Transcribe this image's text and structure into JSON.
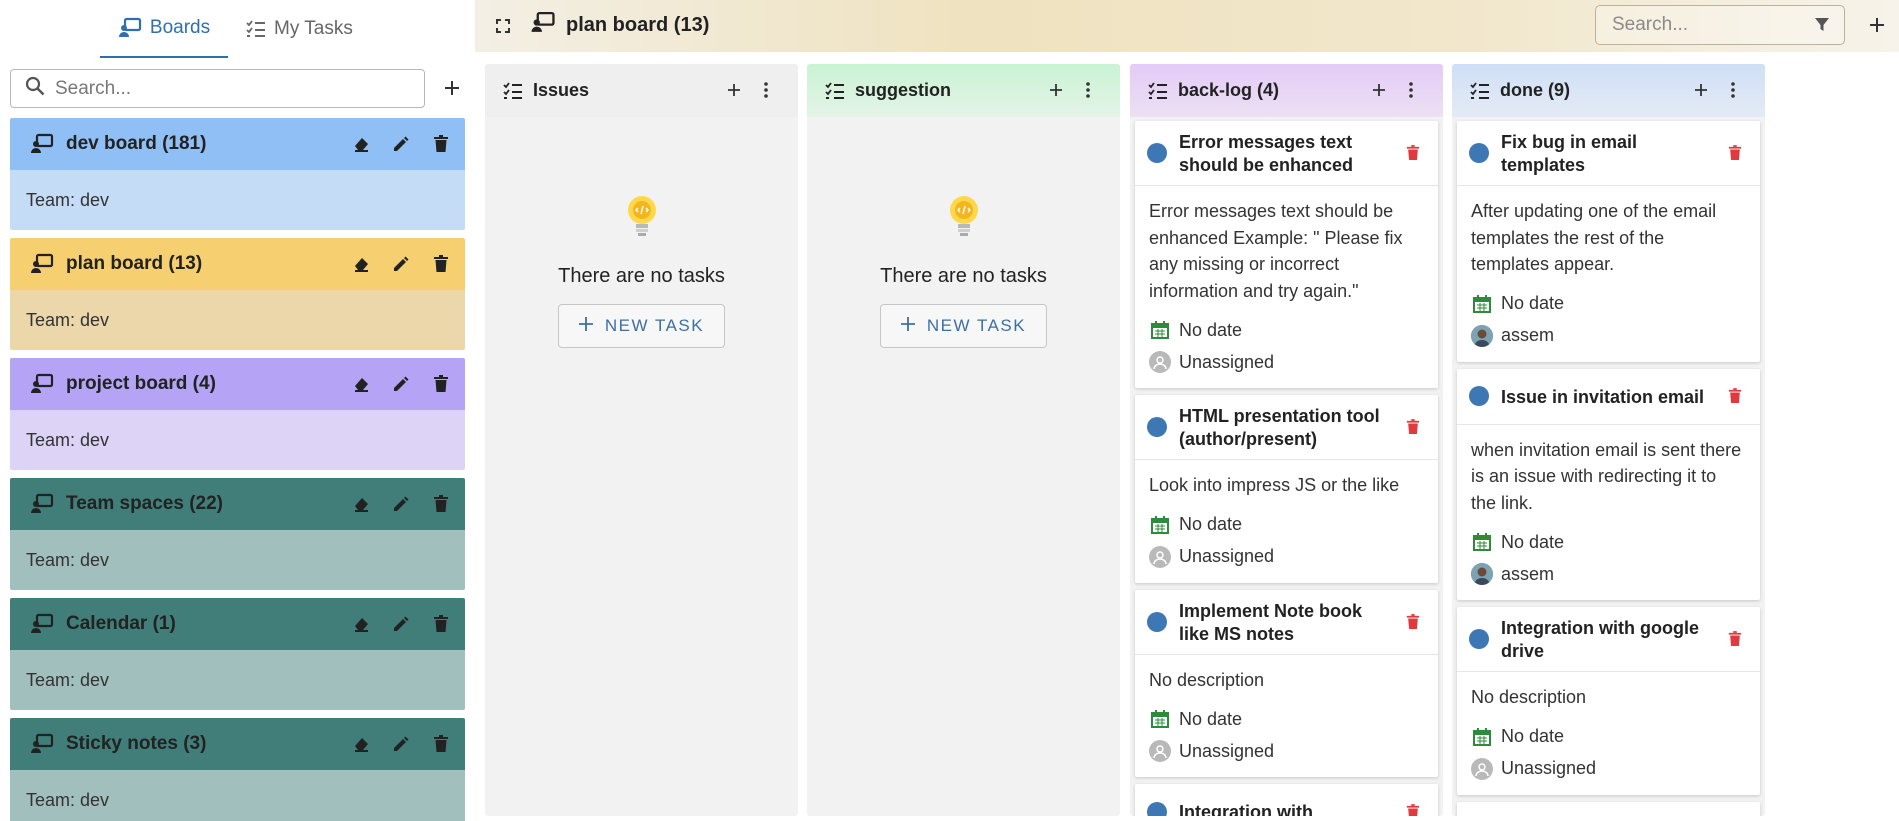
{
  "sidebar": {
    "tabs": [
      {
        "label": "Boards",
        "icon": "board-icon",
        "active": true
      },
      {
        "label": "My Tasks",
        "icon": "checklist-icon",
        "active": false
      }
    ],
    "search": {
      "placeholder": "Search..."
    },
    "boards": [
      {
        "title": "dev board (181)",
        "team": "Team: dev",
        "head_color": "#90bff5",
        "body_color": "#c4dcf6"
      },
      {
        "title": "plan board (13)",
        "team": "Team: dev",
        "head_color": "#f5cf70",
        "body_color": "#ebd7aa"
      },
      {
        "title": "project board (4)",
        "team": "Team: dev",
        "head_color": "#b5a4f5",
        "body_color": "#dcd3f7"
      },
      {
        "title": "Team spaces (22)",
        "team": "Team: dev",
        "head_color": "#417e7a",
        "body_color": "#a1bfbd"
      },
      {
        "title": "Calendar (1)",
        "team": "Team: dev",
        "head_color": "#417e7a",
        "body_color": "#a1bfbd"
      },
      {
        "title": "Sticky notes (3)",
        "team": "Team: dev",
        "head_color": "#417e7a",
        "body_color": "#a1bfbd"
      }
    ]
  },
  "header": {
    "title": "plan board (13)",
    "search": {
      "placeholder": "Search..."
    }
  },
  "columns": [
    {
      "title": "Issues",
      "header_color": "#efefef",
      "empty_text": "There are no tasks",
      "new_task_label": "NEW TASK",
      "tasks": []
    },
    {
      "title": "suggestion",
      "header_color": "#c9f3d3",
      "empty_text": "There are no tasks",
      "new_task_label": "NEW TASK",
      "tasks": []
    },
    {
      "title": "back-log (4)",
      "header_color": "#e6cff6",
      "tasks": [
        {
          "title": "Error messages text should be enhanced",
          "desc": "Error messages text should be enhanced Example: \" Please fix any missing or incorrect information and try again.\"",
          "date": "No date",
          "assignee": "Unassigned",
          "avatar": "gray"
        },
        {
          "title": "HTML presentation tool (author/present)",
          "desc": "Look into impress JS or the like",
          "date": "No date",
          "assignee": "Unassigned",
          "avatar": "gray"
        },
        {
          "title": "Implement Note book like MS notes",
          "desc": "No description",
          "date": "No date",
          "assignee": "Unassigned",
          "avatar": "gray"
        },
        {
          "title": "Integration with",
          "desc": "",
          "date": "",
          "assignee": "",
          "avatar": "gray"
        }
      ]
    },
    {
      "title": "done (9)",
      "header_color": "#d3e1f5",
      "tasks": [
        {
          "title": "Fix bug in email templates",
          "desc": "After updating one of the email templates the rest of the templates appear.",
          "date": "No date",
          "assignee": "assem",
          "avatar": "user"
        },
        {
          "title": "Issue in invitation email",
          "desc": "when invitation email is sent there is an issue with redirecting it to the link.",
          "date": "No date",
          "assignee": "assem",
          "avatar": "user"
        },
        {
          "title": "Integration with google drive",
          "desc": "No description",
          "date": "No date",
          "assignee": "Unassigned",
          "avatar": "gray"
        }
      ]
    }
  ],
  "colors": {
    "accent": "#2f6fb0",
    "delete": "#e0393e",
    "calendar": "#2e8b3a",
    "task_dot": "#3e78b4"
  }
}
